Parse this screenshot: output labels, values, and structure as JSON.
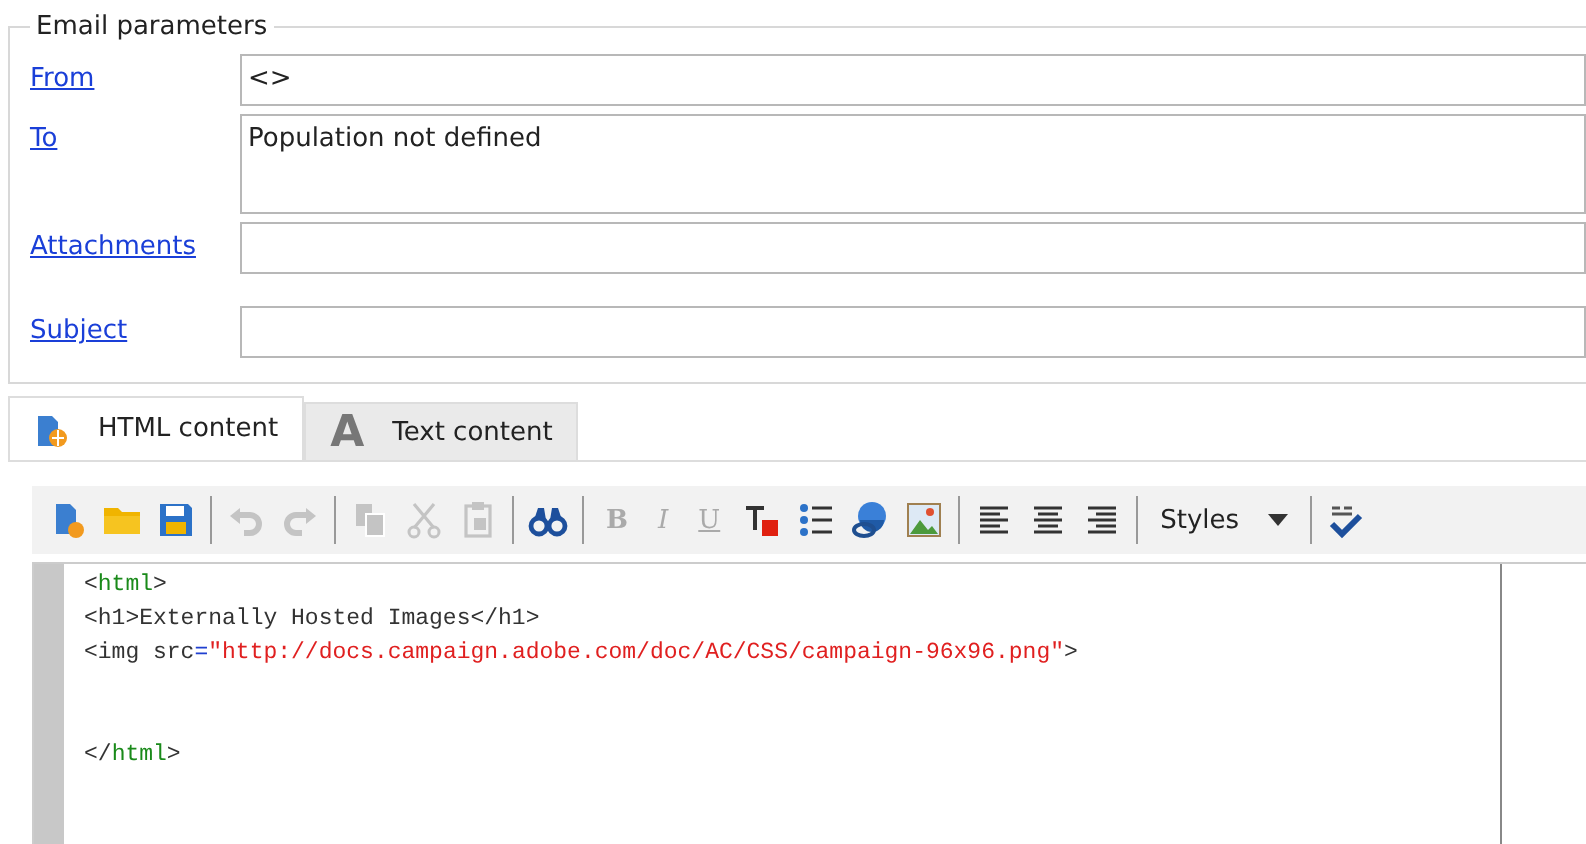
{
  "email_parameters": {
    "title": "Email parameters",
    "fields": [
      {
        "label": "From",
        "value": "<>",
        "kind": "single"
      },
      {
        "label": "To",
        "value": "Population not defined",
        "kind": "multi"
      },
      {
        "label": "Attachments",
        "kind": "single"
      },
      {
        "label": "Subject",
        "kind": "single"
      }
    ]
  },
  "tabs": [
    {
      "label": "HTML content",
      "selected": true
    },
    {
      "label": "Text content",
      "icon_glyph": "A",
      "selected": false
    }
  ],
  "toolbar": [
    {
      "kind": "icon",
      "disabled": false
    },
    {
      "kind": "icon",
      "disabled": false
    },
    {
      "kind": "icon",
      "disabled": false
    },
    {
      "kind": "separator"
    },
    {
      "kind": "icon",
      "disabled": true
    },
    {
      "kind": "icon",
      "disabled": true
    },
    {
      "kind": "separator"
    },
    {
      "kind": "icon",
      "disabled": true
    },
    {
      "kind": "icon",
      "disabled": true
    },
    {
      "kind": "icon",
      "disabled": true
    },
    {
      "kind": "separator"
    },
    {
      "kind": "icon",
      "disabled": false
    },
    {
      "kind": "separator"
    },
    {
      "kind": "glyph",
      "label": "B",
      "disabled": true
    },
    {
      "kind": "glyph",
      "label": "I",
      "disabled": true
    },
    {
      "kind": "glyph",
      "label": "U",
      "disabled": true
    },
    {
      "kind": "icon",
      "disabled": false
    },
    {
      "kind": "icon",
      "disabled": false
    },
    {
      "kind": "icon",
      "disabled": false
    },
    {
      "kind": "icon",
      "disabled": false
    },
    {
      "kind": "separator"
    },
    {
      "kind": "icon",
      "disabled": false
    },
    {
      "kind": "icon",
      "disabled": false
    },
    {
      "kind": "icon",
      "disabled": false
    },
    {
      "kind": "separator"
    },
    {
      "kind": "dropdown",
      "label": "Styles"
    },
    {
      "kind": "separator"
    },
    {
      "kind": "icon",
      "disabled": false
    }
  ],
  "code_lines": [
    [
      {
        "text": "<",
        "kind": "punct"
      },
      {
        "text": "html",
        "kind": "tag"
      },
      {
        "text": ">",
        "kind": "punct"
      }
    ],
    [
      {
        "text": "<h1>Externally Hosted Images</h1>",
        "kind": "punct"
      }
    ],
    [
      {
        "text": "<img src",
        "kind": "punct"
      },
      {
        "text": "=",
        "kind": "equals"
      },
      {
        "text": "\"http://docs.campaign.adobe.com/doc/AC/CSS/campaign-96x96.png\"",
        "kind": "string"
      },
      {
        "text": ">",
        "kind": "punct"
      }
    ],
    [
      {
        "text": "</",
        "kind": "punct"
      },
      {
        "text": "html",
        "kind": "tag"
      },
      {
        "text": ">",
        "kind": "punct"
      }
    ]
  ]
}
